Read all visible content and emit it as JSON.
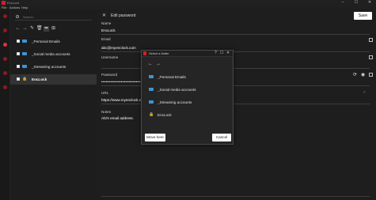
{
  "window": {
    "app_title": "EncLock",
    "controls": {
      "minimize": "–",
      "maximize": "☐",
      "close": "✕"
    }
  },
  "menu": [
    "File",
    "Actions",
    "Help"
  ],
  "sidebar": {
    "search_placeholder": "Search...",
    "toolbar": {
      "back": "←",
      "forward": "→",
      "edit": "✎",
      "delete": "🗑",
      "move": "➥",
      "new_folder": "⊞"
    },
    "folders": [
      {
        "label": "_Personal Emails",
        "icon": "folder-icon",
        "selected": false
      },
      {
        "label": "_Social media accounts",
        "icon": "folder-icon",
        "selected": false
      },
      {
        "label": "_Streaming accounts",
        "icon": "folder-icon",
        "selected": false
      },
      {
        "label": "EncLock",
        "icon": "lock-icon",
        "selected": true
      }
    ]
  },
  "editor": {
    "close": "✕",
    "title": "Edit password",
    "save_label": "Save",
    "fields": {
      "name_label": "Name",
      "name_value": "EncLock",
      "email_label": "Email",
      "email_value": "abc@myenclock.com",
      "username_label": "Username",
      "username_value": "",
      "password_label": "Password",
      "password_value": "••••••••••••••••••••••••••••",
      "url_label": "URL",
      "url_value": "https://www.myenclock.com",
      "notes_label": "Notes",
      "notes_value": "Abi's email address."
    }
  },
  "dialog": {
    "title": "Select a folder",
    "controls": {
      "help": "?",
      "maximize": "☐",
      "close": "✕"
    },
    "nav": {
      "back": "←",
      "forward": "→"
    },
    "folders": [
      {
        "label": "_Personal Emails",
        "icon": "folder-icon"
      },
      {
        "label": "_Social media accounts",
        "icon": "folder-icon"
      },
      {
        "label": "_Streaming accounts",
        "icon": "folder-icon"
      },
      {
        "label": "EncLock",
        "icon": "lock-icon"
      }
    ],
    "move_label": "Move here",
    "cancel_label": "Cancel"
  },
  "colors": {
    "accent": "#d0202a",
    "folder": "#3c95d6",
    "link": "#3c95d6"
  }
}
